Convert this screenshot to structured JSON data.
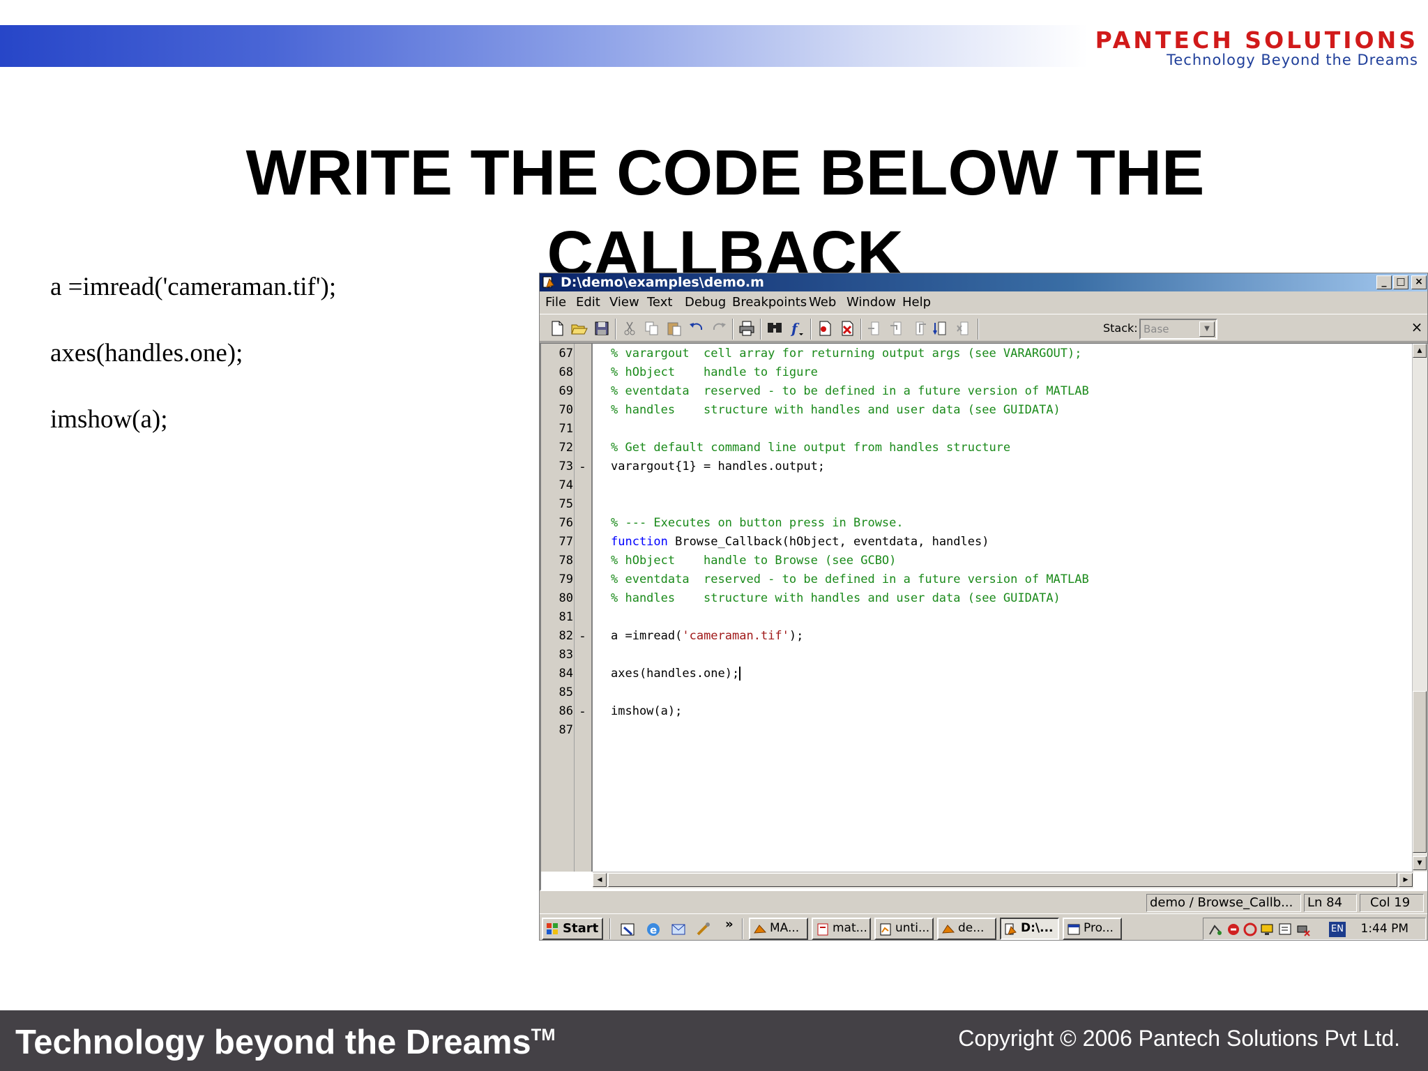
{
  "slide": {
    "title_line1": "WRITE THE CODE BELOW THE",
    "title_line2": "CALLBACK",
    "notes": [
      "a =imread('cameraman.tif');",
      "axes(handles.one);",
      "imshow(a);"
    ],
    "footer_left": "Technology beyond the Dreams",
    "footer_tm": "TM",
    "footer_right": "Copyright © 2006 Pantech Solutions Pvt Ltd."
  },
  "logo": {
    "name": "PANTECH SOLUTIONS",
    "tagline": "Technology Beyond the Dreams"
  },
  "window": {
    "title": "D:\\demo\\examples\\demo.m",
    "controls": {
      "minimize": "_",
      "maximize": "□",
      "close": "×"
    },
    "menu": [
      "File",
      "Edit",
      "View",
      "Text",
      "Debug",
      "Breakpoints",
      "Web",
      "Window",
      "Help"
    ],
    "toolbar": {
      "icons": [
        "new-file-icon",
        "open-folder-icon",
        "save-icon",
        "cut-icon",
        "copy-icon",
        "paste-icon",
        "undo-icon",
        "redo-icon",
        "print-icon",
        "find-icon",
        "function-icon",
        "set-breakpoint-icon",
        "clear-breakpoints-icon",
        "step-icon",
        "step-in-icon",
        "step-out-icon",
        "continue-icon",
        "exit-debug-icon"
      ],
      "stack_label": "Stack:",
      "stack_value": "Base",
      "close_glyph": "×"
    },
    "editor": {
      "lines": [
        {
          "n": "67",
          "mark": "",
          "type": "comment",
          "text": "% varargout  cell array for returning output args (see VARARGOUT);"
        },
        {
          "n": "68",
          "mark": "",
          "type": "comment",
          "text": "% hObject    handle to figure"
        },
        {
          "n": "69",
          "mark": "",
          "type": "comment",
          "text": "% eventdata  reserved - to be defined in a future version of MATLAB"
        },
        {
          "n": "70",
          "mark": "",
          "type": "comment",
          "text": "% handles    structure with handles and user data (see GUIDATA)"
        },
        {
          "n": "71",
          "mark": "",
          "type": "plain",
          "text": ""
        },
        {
          "n": "72",
          "mark": "",
          "type": "comment",
          "text": "% Get default command line output from handles structure"
        },
        {
          "n": "73",
          "mark": "-",
          "type": "plain",
          "text": "varargout{1} = handles.output;"
        },
        {
          "n": "74",
          "mark": "",
          "type": "plain",
          "text": ""
        },
        {
          "n": "75",
          "mark": "",
          "type": "plain",
          "text": ""
        },
        {
          "n": "76",
          "mark": "",
          "type": "comment",
          "text": "% --- Executes on button press in Browse."
        },
        {
          "n": "77",
          "mark": "",
          "type": "function",
          "keyword": "function",
          "text": " Browse_Callback(hObject, eventdata, handles)"
        },
        {
          "n": "78",
          "mark": "",
          "type": "comment",
          "text": "% hObject    handle to Browse (see GCBO)"
        },
        {
          "n": "79",
          "mark": "",
          "type": "comment",
          "text": "% eventdata  reserved - to be defined in a future version of MATLAB"
        },
        {
          "n": "80",
          "mark": "",
          "type": "comment",
          "text": "% handles    structure with handles and user data (see GUIDATA)"
        },
        {
          "n": "81",
          "mark": "",
          "type": "plain",
          "text": ""
        },
        {
          "n": "82",
          "mark": "-",
          "type": "string",
          "pre": "a =imread(",
          "str": "'cameraman.tif'",
          "post": ");"
        },
        {
          "n": "83",
          "mark": "",
          "type": "plain",
          "text": ""
        },
        {
          "n": "84",
          "mark": "",
          "type": "cursor",
          "text": "axes(handles.one);"
        },
        {
          "n": "85",
          "mark": "",
          "type": "plain",
          "text": ""
        },
        {
          "n": "86",
          "mark": "-",
          "type": "plain",
          "text": "imshow(a);"
        },
        {
          "n": "87",
          "mark": "",
          "type": "plain",
          "text": ""
        }
      ]
    },
    "status": {
      "context": "demo / Browse_Callb...",
      "line": "Ln 84",
      "col": "Col 19"
    }
  },
  "taskbar": {
    "start_label": "Start",
    "more": "»",
    "tasks": [
      {
        "label": "MA...",
        "icon": "matlab-icon",
        "active": false
      },
      {
        "label": "mat...",
        "icon": "document-icon",
        "active": false
      },
      {
        "label": "unti...",
        "icon": "figure-icon",
        "active": false
      },
      {
        "label": "de...",
        "icon": "matlab-icon",
        "active": false
      },
      {
        "label": "D:\\...",
        "icon": "editor-icon",
        "active": true
      },
      {
        "label": "Pro...",
        "icon": "window-icon",
        "active": false
      }
    ],
    "tray_lang": "EN",
    "clock": "1:44 PM"
  }
}
